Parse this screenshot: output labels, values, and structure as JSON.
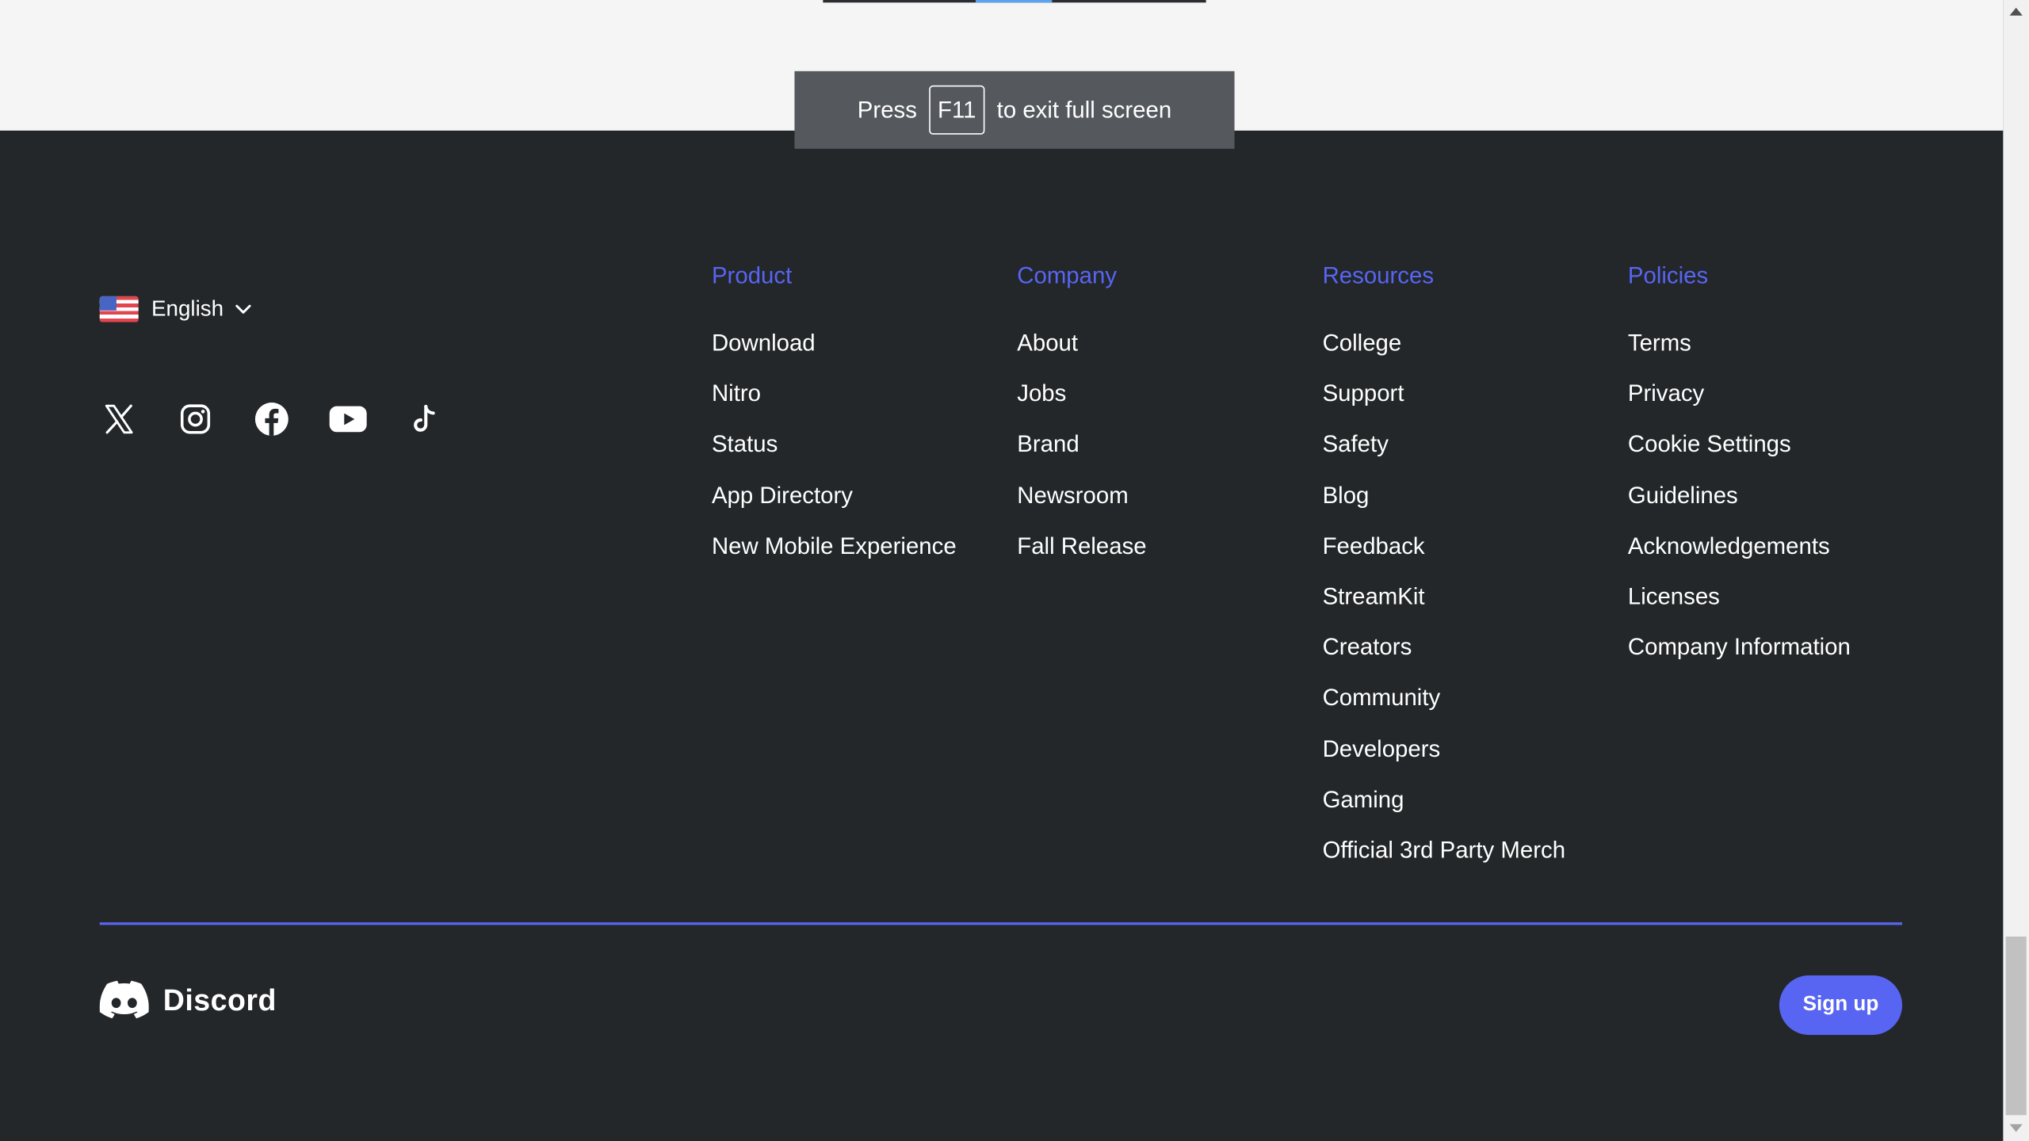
{
  "fullscreen_banner": {
    "before": "Press",
    "key": "F11",
    "after": "to exit full screen"
  },
  "language": {
    "selected": "English",
    "flag_icon": "us-flag-icon",
    "chevron_icon": "chevron-down-icon"
  },
  "socials": [
    {
      "name": "x-twitter-icon"
    },
    {
      "name": "instagram-icon"
    },
    {
      "name": "facebook-icon"
    },
    {
      "name": "youtube-icon"
    },
    {
      "name": "tiktok-icon"
    }
  ],
  "columns": {
    "product": {
      "title": "Product",
      "links": [
        "Download",
        "Nitro",
        "Status",
        "App Directory",
        "New Mobile Experience"
      ]
    },
    "company": {
      "title": "Company",
      "links": [
        "About",
        "Jobs",
        "Brand",
        "Newsroom",
        "Fall Release"
      ]
    },
    "resources": {
      "title": "Resources",
      "links": [
        "College",
        "Support",
        "Safety",
        "Blog",
        "Feedback",
        "StreamKit",
        "Creators",
        "Community",
        "Developers",
        "Gaming",
        "Official 3rd Party Merch"
      ]
    },
    "policies": {
      "title": "Policies",
      "links": [
        "Terms",
        "Privacy",
        "Cookie Settings",
        "Guidelines",
        "Acknowledgements",
        "Licenses",
        "Company Information"
      ]
    }
  },
  "brand": {
    "name": "Discord",
    "logo_icon": "discord-logo-icon"
  },
  "signup": {
    "label": "Sign up"
  },
  "colors": {
    "footer_bg": "#23272a",
    "accent": "#5865f2",
    "top_band": "#f5f5f5",
    "banner_bg": "#55585d"
  }
}
